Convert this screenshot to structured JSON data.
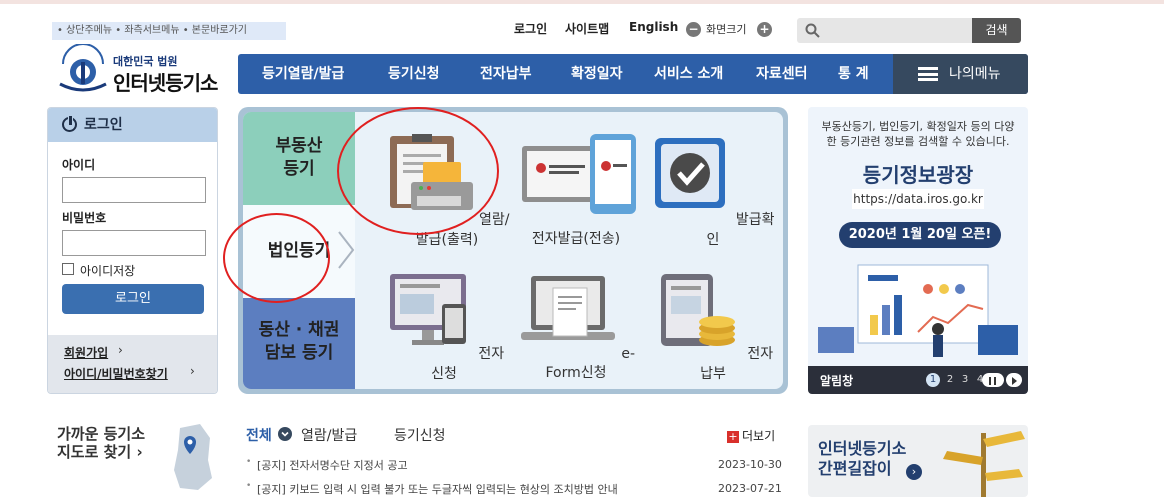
{
  "skip_links": "• 상단주메뉴 • 좌측서브메뉴 • 본문바로가기",
  "util": {
    "login": "로그인",
    "sitemap": "사이트맵",
    "english": "English",
    "zoom": "화면크기",
    "zoom_out": "−",
    "zoom_in": "+"
  },
  "search": {
    "placeholder": "",
    "button": "검색"
  },
  "logo": {
    "sub": "대한민국 법원",
    "main": "인터넷등기소"
  },
  "gnb": {
    "items": [
      "등기열람/발급",
      "등기신청",
      "전자납부",
      "확정일자",
      "서비스 소개",
      "자료센터",
      "통 계"
    ],
    "my_menu": "나의메뉴"
  },
  "login": {
    "title": "로그인",
    "id_label": "아이디",
    "pw_label": "비밀번호",
    "save_id": "아이디저장",
    "button": "로그인",
    "join": "회원가입",
    "find": "아이디/비밀번호찾기"
  },
  "center": {
    "tabs": {
      "real_estate": "부동산 등기",
      "corporate": "법인등기",
      "movable": "동산 · 채권 담보 등기"
    },
    "services": [
      "열람/발급(출력)",
      "전자발급(전송)",
      "발급확인",
      "전자신청",
      "e-Form신청",
      "전자납부"
    ]
  },
  "banner": {
    "intro": "부동산등기, 법인등기, 확정일자 등의 다양한 등기관련 정보를 검색할 수 있습니다.",
    "title": "등기정보광장",
    "url": "https://data.iros.go.kr",
    "date": "2020년 1월 20일 오픈!",
    "alarm": "알림창",
    "pages": [
      "1",
      "2",
      "3",
      "4"
    ]
  },
  "near": {
    "line1": "가까운 등기소",
    "line2": "지도로 찾기 ›"
  },
  "news": {
    "tabs": [
      "전체",
      "열람/발급",
      "등기신청"
    ],
    "more": "더보기",
    "items": [
      {
        "title": "[공지] 전자서명수단 지정서 공고",
        "date": "2023-10-30"
      },
      {
        "title": "[공지] 키보드 입력 시 입력 불가 또는 두글자씩 입력되는 현상의 조치방법 안내",
        "date": "2023-07-21"
      }
    ]
  },
  "guide": {
    "line1": "인터넷등기소",
    "line2": "간편길잡이"
  },
  "colors": {
    "nav": "#2d5fa8",
    "my_menu": "#36495f",
    "tab_green": "#8ccfbb",
    "tab_blue": "#5c7ec0",
    "annotation": "#e02020"
  }
}
